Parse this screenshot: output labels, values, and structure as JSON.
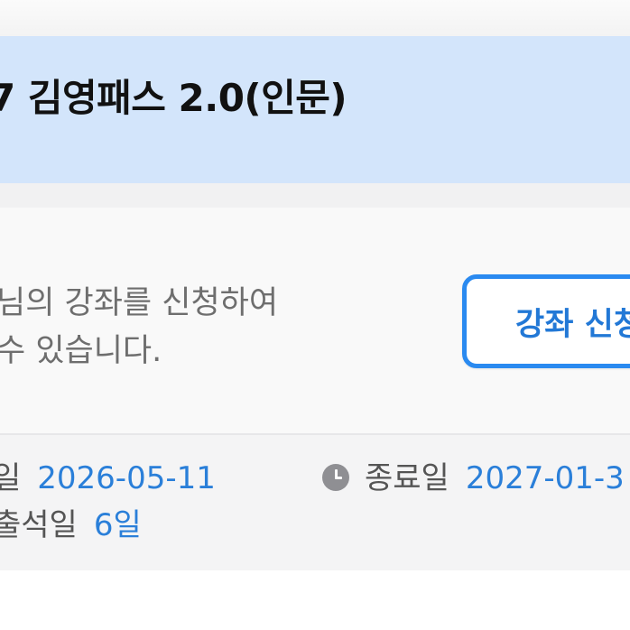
{
  "course": {
    "title": "7 김영패스 2.0(인문)"
  },
  "description": {
    "line1": "님의 강좌를 신청하여",
    "line2": "수 있습니다."
  },
  "buttons": {
    "apply_label": "강좌 신청"
  },
  "schedule": {
    "start_label_fragment": "일",
    "start_date": "2026-05-11",
    "end_label": "종료일",
    "end_date": "2027-01-3",
    "attendance_label_fragment": "출석일",
    "attendance_value": "6일"
  },
  "icons": {
    "end_date": "clock-icon"
  },
  "colors": {
    "header_bg": "#d3e5fb",
    "accent": "#2a8af0",
    "value_text": "#2a7fd9"
  }
}
